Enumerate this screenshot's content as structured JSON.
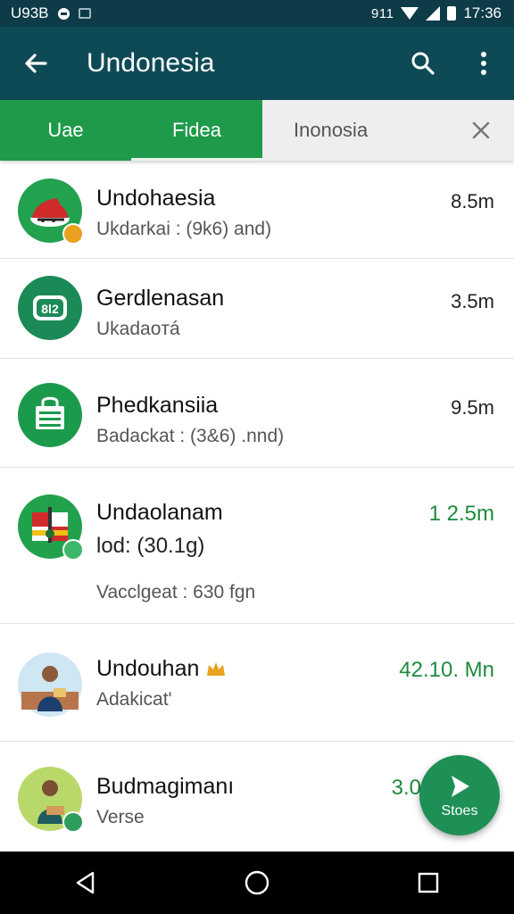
{
  "status_bar": {
    "left_text": "U93B",
    "time": "17:36",
    "network": "911",
    "icons": [
      "circle-icon",
      "image-icon",
      "wifi-icon",
      "signal-icon",
      "battery-icon"
    ]
  },
  "app_bar": {
    "title": "Undonesia",
    "icons": [
      "back-arrow-icon",
      "search-icon",
      "more-vert-icon"
    ]
  },
  "tabs": [
    {
      "label": "Uae"
    },
    {
      "label": "Fidea",
      "active": true
    }
  ],
  "search": {
    "value": "Inonosia"
  },
  "items": [
    {
      "title": "Undohaesia",
      "subtitle": "Ukdarkai : (9k6) and)",
      "size": "8.5m"
    },
    {
      "title": "Gerdlenasan",
      "subtitle": "Ukadaoтá",
      "size": "3.5m",
      "avatar_text": "8l2"
    },
    {
      "title": "Phedkansiia",
      "subtitle": "Badackat : (3&6) .nnd)",
      "size": "9.5m"
    },
    {
      "title": "Undaolanam",
      "subtitle": "lod: (30.1g)",
      "subtitle2": "Vacclgeat : 630 fgn",
      "size": "1 2.5m"
    },
    {
      "title": "Undouhan",
      "subtitle": "Adakicat'",
      "size": "42.10. Mn"
    },
    {
      "title": "Budmagimanı",
      "subtitle": "Verse",
      "size": "3.0"
    }
  ],
  "fab": {
    "label": "Stoes"
  },
  "colors": {
    "app_bar": "#0e4a55",
    "status_bar": "#0d3b47",
    "tab_green": "#1f9a4a",
    "accent_green": "#1e8a3e",
    "fab": "#1e8f55"
  },
  "nav_icons": [
    "back-triangle-icon",
    "home-circle-icon",
    "recents-square-icon"
  ]
}
